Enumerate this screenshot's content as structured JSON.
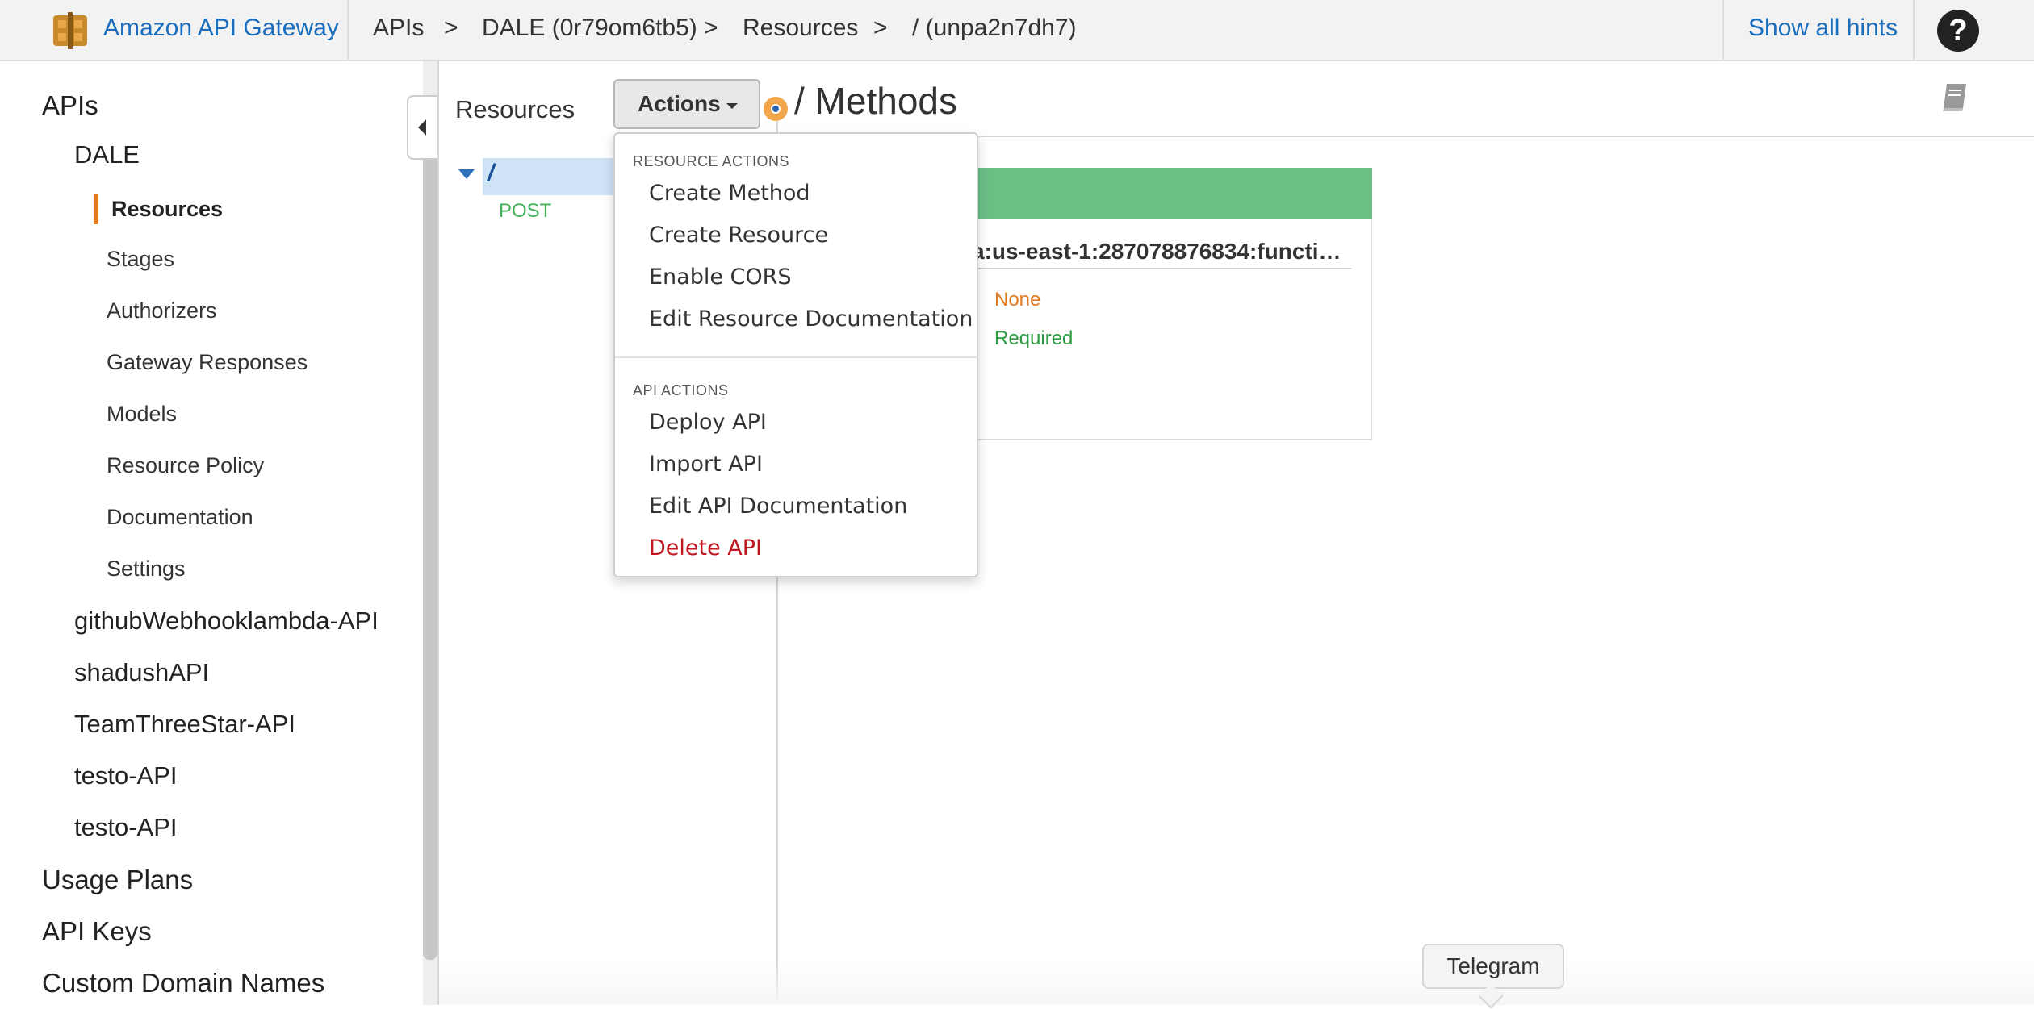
{
  "header": {
    "app_name": "Amazon API Gateway",
    "breadcrumbs": [
      "APIs",
      "DALE (0r79om6tb5)",
      "Resources",
      "/ (unpa2n7dh7)"
    ],
    "separator": ">",
    "show_hints_label": "Show all hints",
    "help_label": "?"
  },
  "sidebar": {
    "apis_label": "APIs",
    "current_api": "DALE",
    "api_items": [
      "Resources",
      "Stages",
      "Authorizers",
      "Gateway Responses",
      "Models",
      "Resource Policy",
      "Documentation",
      "Settings"
    ],
    "other_apis": [
      "githubWebhooklambda-API",
      "shadushAPI",
      "TeamThreeStar-API",
      "testo-API",
      "testo-API"
    ],
    "bottom_items": [
      "Usage Plans",
      "API Keys",
      "Custom Domain Names"
    ]
  },
  "resources_panel": {
    "title": "Resources",
    "actions_label": "Actions",
    "tree_root": "/",
    "tree_method": "POST"
  },
  "actions_menu": {
    "resource_section": "RESOURCE ACTIONS",
    "resource_actions": [
      "Create Method",
      "Create Resource",
      "Enable CORS",
      "Edit Resource Documentation"
    ],
    "api_section": "API ACTIONS",
    "api_actions": [
      "Deploy API",
      "Import API",
      "Edit API Documentation",
      "Delete API"
    ]
  },
  "main": {
    "title": "/ Methods",
    "card_arn": "a:us-east-1:287078876834:functi…",
    "auth_value": "None",
    "api_key_value": "Required"
  },
  "tooltip": "Telegram",
  "colors": {
    "brand_blue": "#1a6ebd",
    "accent_orange": "#e07b1f",
    "method_green": "#6abf85",
    "danger_red": "#c0161f"
  }
}
